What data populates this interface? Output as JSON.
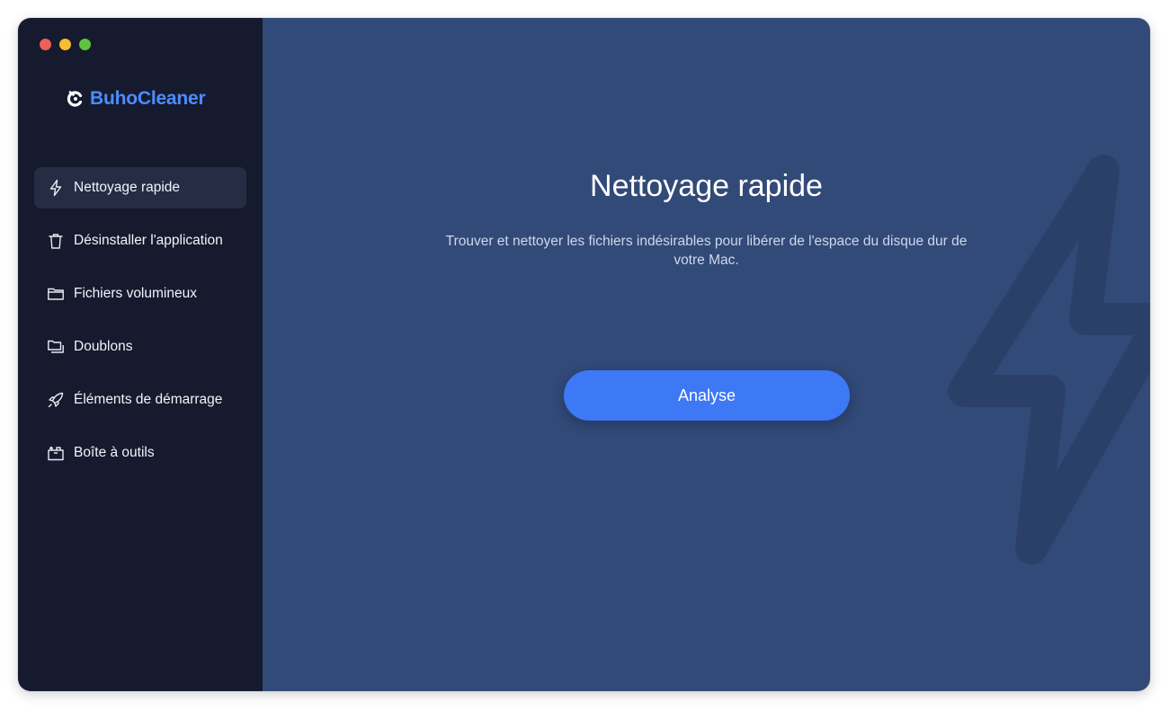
{
  "app": {
    "name": "BuhoCleaner",
    "brand_color": "#4c8dff"
  },
  "sidebar": {
    "items": [
      {
        "label": "Nettoyage rapide",
        "icon": "lightning-icon",
        "active": true
      },
      {
        "label": "Désinstaller l'application",
        "icon": "trash-icon",
        "active": false
      },
      {
        "label": "Fichiers volumineux",
        "icon": "folder-icon",
        "active": false
      },
      {
        "label": "Doublons",
        "icon": "duplicate-folders-icon",
        "active": false
      },
      {
        "label": "Éléments de démarrage",
        "icon": "rocket-icon",
        "active": false
      },
      {
        "label": "Boîte à outils",
        "icon": "toolbox-icon",
        "active": false
      }
    ]
  },
  "main": {
    "title": "Nettoyage rapide",
    "description": "Trouver et nettoyer les fichiers indésirables pour libérer de l'espace du disque dur de votre Mac.",
    "analyse_label": "Analyse",
    "background_icon": "lightning-icon"
  },
  "colors": {
    "sidebar_bg": "#151a2e",
    "main_bg": "#324a78",
    "button": "#3d78f5"
  }
}
